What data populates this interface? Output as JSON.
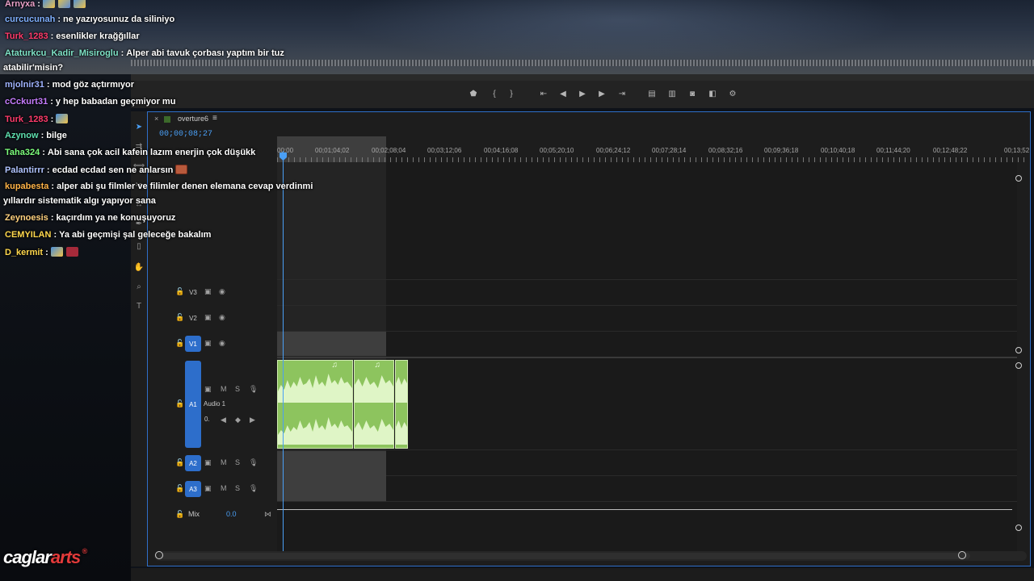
{
  "sequence": {
    "tab_close": "×",
    "tab_title": "overture6",
    "tab_menu": "≡",
    "timecode": "00;00;08;27",
    "ruler_labels": [
      "00;00",
      "00;01;04;02",
      "00;02;08;04",
      "00;03;12;06",
      "00;04;16;08",
      "00;05;20;10",
      "00;06;24;12",
      "00;07;28;14",
      "00;08;32;16",
      "00;09;36;18",
      "00;10;40;18",
      "00;11;44;20",
      "00;12;48;22",
      "00;13;52"
    ]
  },
  "tracks": {
    "v3": "V3",
    "v2": "V2",
    "v1": "V1",
    "a1": "A1",
    "a1_name": "Audio 1",
    "a2": "A2",
    "a3": "A3",
    "mute": "M",
    "solo": "S",
    "mix_label": "Mix",
    "mix_value": "0.0",
    "volume_value": "0."
  },
  "icons": {
    "clip_note": "♫"
  },
  "chat": [
    {
      "user": "Arnyxa",
      "color": "#e8a0c8",
      "text": "",
      "emotes": [
        "blue",
        "mixed",
        "blue"
      ]
    },
    {
      "user": "curcucunah",
      "color": "#7fb0ff",
      "text": "ne yazıyosunuz da siliniyo",
      "emotes": []
    },
    {
      "user": "Turk_1283",
      "color": "#ff3b6b",
      "text": "esenlikler krağğıllar",
      "emotes": []
    },
    {
      "user": "Ataturkcu_Kadir_Misiroglu",
      "color": "#7fe3c7",
      "text": "Alper abi tavuk çorbası yaptım bir tuz",
      "emotes": []
    },
    {
      "user": "",
      "color": "#ffffff",
      "text": "atabilir'misin?",
      "emotes": []
    },
    {
      "user": "mjolnir31",
      "color": "#9fb3ff",
      "text": "mod göz açtırmıyor",
      "emotes": []
    },
    {
      "user": "cCckurt31",
      "color": "#c77dff",
      "text": "y hep babadan geçmiyor mu",
      "emotes": []
    },
    {
      "user": "Turk_1283",
      "color": "#ff3b6b",
      "text": "",
      "emotes": [
        "blue"
      ]
    },
    {
      "user": "Azynow",
      "color": "#5fe0b0",
      "text": "bilge",
      "emotes": []
    },
    {
      "user": "Taha324",
      "color": "#7dff7d",
      "text": "Abi sana çok acil kafein lazım enerjin çok düşükk",
      "emotes": []
    },
    {
      "user": "Palantirrr",
      "color": "#b0c4ff",
      "text": "ecdad ecdad sen ne anlarsın",
      "emotes": [
        "brick"
      ]
    },
    {
      "user": "kupabesta",
      "color": "#ffb347",
      "text": "alper abi şu filmler ve filimler denen elemana cevap verdinmi",
      "emotes": []
    },
    {
      "user": "",
      "color": "#ffffff",
      "text": "yıllardır sistematik algı yapıyor sana",
      "emotes": []
    },
    {
      "user": "Zeynoesis",
      "color": "#ffd27f",
      "text": "kaçırdım ya ne konuşuyoruz",
      "emotes": []
    },
    {
      "user": "CEMYILAN",
      "color": "#ffd84d",
      "text": "Ya abi geçmişi şal geleceğe bakalım",
      "emotes": []
    },
    {
      "user": "D_kermit",
      "color": "#ffd84d",
      "text": "",
      "emotes": [
        "blue",
        "rose"
      ]
    }
  ],
  "logo": {
    "part1": "caglar",
    "part2": "arts",
    "mark": "®"
  },
  "colors": {
    "accent": "#2d6ecb",
    "clip_green": "#8dc45e",
    "playhead": "#4a9ff5"
  }
}
